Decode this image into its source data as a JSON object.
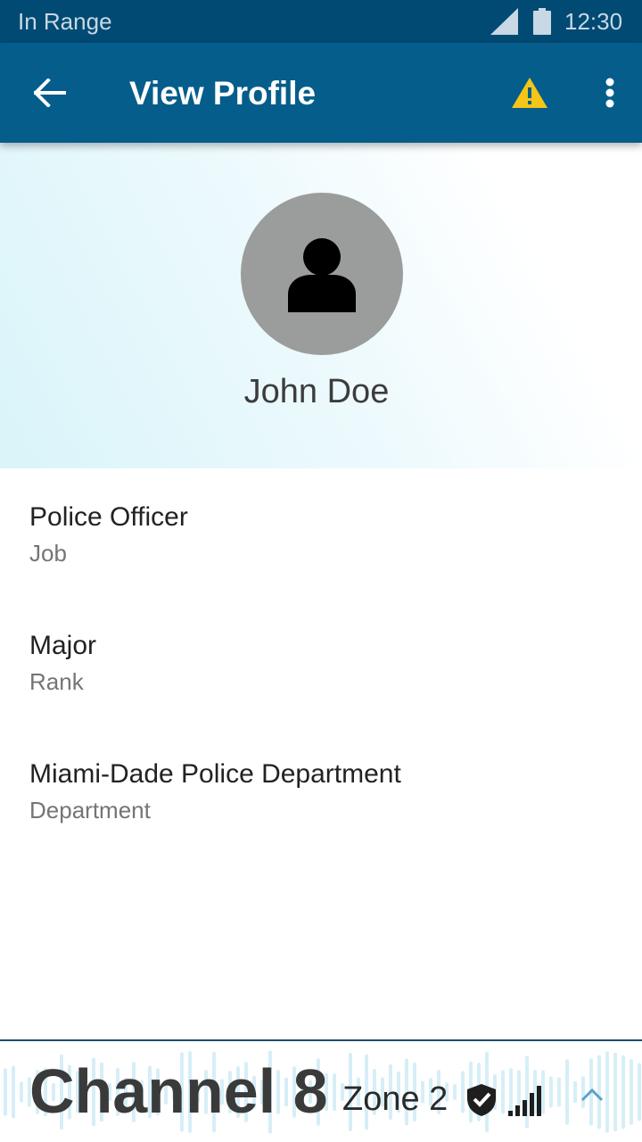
{
  "status_bar": {
    "connection": "In Range",
    "time": "12:30",
    "icons": [
      "signal-icon",
      "battery-icon"
    ]
  },
  "app_bar": {
    "title": "View Profile",
    "icons": [
      "back-arrow-icon",
      "warning-icon",
      "more-vert-icon"
    ],
    "warning_color": "#f5c518"
  },
  "profile": {
    "name": "John Doe",
    "avatar_icon": "person-icon"
  },
  "fields": [
    {
      "value": "Police Officer",
      "label": "Job"
    },
    {
      "value": "Major",
      "label": "Rank"
    },
    {
      "value": "Miami-Dade Police Department",
      "label": "Department"
    }
  ],
  "bottom_bar": {
    "channel": "Channel 8",
    "zone": "Zone 2",
    "icons": [
      "shield-check-icon",
      "signal-bars-icon",
      "chevron-up-icon",
      "waveform"
    ]
  },
  "colors": {
    "status_bar": "#004a73",
    "app_bar": "#055d8b",
    "accent": "#5ba3c6"
  }
}
